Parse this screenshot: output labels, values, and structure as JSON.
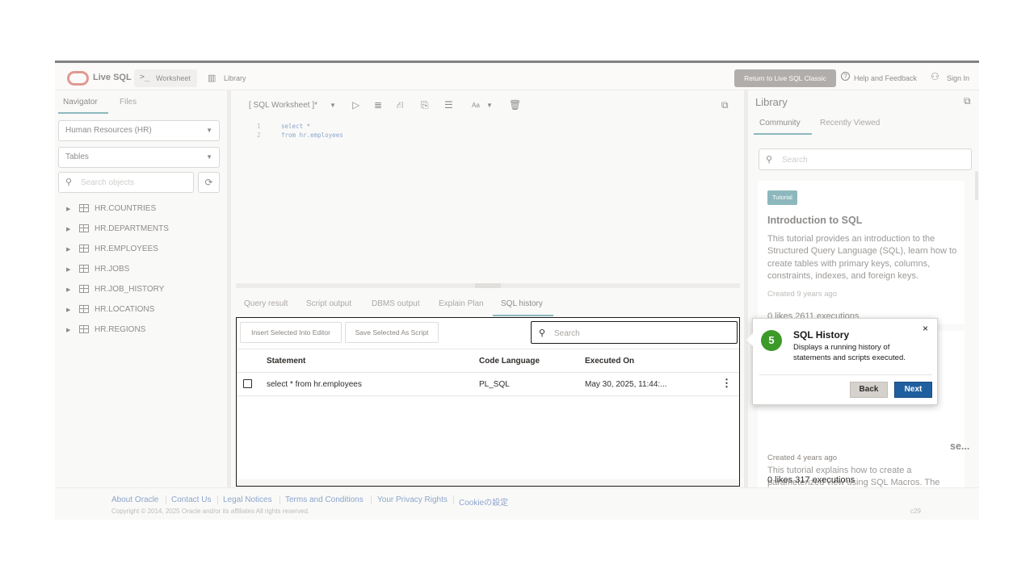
{
  "header": {
    "brand": "Live SQL",
    "worksheet_icon": ">_",
    "worksheet_label": "Worksheet",
    "library_label": "Library",
    "return_label": "Return to Live SQL Classic",
    "help_label": "Help and Feedback",
    "signin_label": "Sign In",
    "icons": {
      "logo": "oracle-oval-logo",
      "help": "question-circle-icon",
      "user": "user-icon",
      "library": "book-icon"
    }
  },
  "navigator": {
    "tabs": [
      "Navigator",
      "Files"
    ],
    "schema_select": "Human Resources (HR)",
    "type_select": "Tables",
    "search_placeholder": "Search objects",
    "tables": [
      "HR.COUNTRIES",
      "HR.DEPARTMENTS",
      "HR.EMPLOYEES",
      "HR.JOBS",
      "HR.JOB_HISTORY",
      "HR.LOCATIONS",
      "HR.REGIONS"
    ]
  },
  "editor": {
    "title": "[ SQL Worksheet ]*",
    "font_label": "Aa",
    "lines": [
      {
        "num": "1",
        "code": "select *"
      },
      {
        "num": "2",
        "code": "from hr.employees"
      }
    ]
  },
  "results": {
    "tabs": [
      "Query result",
      "Script output",
      "DBMS output",
      "Explain Plan",
      "SQL history"
    ],
    "active_tab": "SQL history",
    "insert_btn": "Insert Selected Into Editor",
    "save_btn": "Save Selected As Script",
    "search_placeholder": "Search",
    "columns": {
      "statement": "Statement",
      "language": "Code Language",
      "executed": "Executed On"
    },
    "rows": [
      {
        "statement": "select * from hr.employees",
        "language": "PL_SQL",
        "executed": "May 30, 2025, 11:44:..."
      }
    ]
  },
  "library": {
    "title": "Library",
    "tabs": [
      "Community",
      "Recently Viewed"
    ],
    "search_placeholder": "Search",
    "cards": [
      {
        "badge": "Tutorial",
        "title": "Introduction to SQL",
        "description": "This tutorial provides an introduction to the Structured Query Language (SQL), learn how to create tables with primary keys, columns, constraints, indexes, and foreign keys.",
        "meta": "Created 9 years ago",
        "stats": "0 likes    2611 executions"
      },
      {
        "title": "se...",
        "description": "This tutorial explains how to create a parameterized view using SQL Macros. The examples use the built-in sales history schema so there are no setup steps.",
        "meta": "Created 4 years ago",
        "stats": "0 likes    317 executions"
      }
    ]
  },
  "footer": {
    "links": [
      "About Oracle",
      "Contact Us",
      "Legal Notices",
      "Terms and Conditions",
      "Your Privacy Rights",
      "Cookieの設定"
    ],
    "copyright": "Copyright © 2014, 2025 Oracle and/or its affiliates All rights reserved.",
    "version": "c29"
  },
  "tour": {
    "step": "5",
    "title": "SQL History",
    "text": "Displays a running history of statements and scripts executed.",
    "back": "Back",
    "next": "Next",
    "close": "×"
  },
  "colors": {
    "accent": "#2f7e87",
    "tour_green": "#3b9a28",
    "next_blue": "#1f5fa0",
    "brand_red": "#c74634"
  }
}
